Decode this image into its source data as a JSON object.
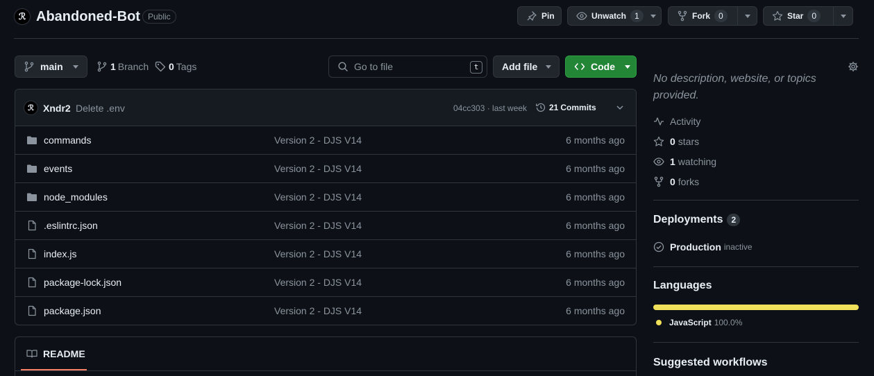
{
  "repo": {
    "name": "Abandoned-Bot",
    "visibility": "Public"
  },
  "actions": {
    "pin": "Pin",
    "unwatch": "Unwatch",
    "watch_count": "1",
    "fork": "Fork",
    "fork_count": "0",
    "star": "Star",
    "star_count": "0"
  },
  "toolbar": {
    "branch": "main",
    "branch_count": "1",
    "branch_label": "Branch",
    "tags_count": "0",
    "tags_label": "Tags",
    "go_to_file_placeholder": "Go to file",
    "go_to_file_key": "t",
    "add_file": "Add file",
    "code": "Code"
  },
  "commit": {
    "author": "Xndr2",
    "message": "Delete .env",
    "meta": "04cc303 · last week",
    "commits_count": "21",
    "commits_label": "Commits"
  },
  "files": [
    {
      "type": "dir",
      "name": "commands",
      "message": "Version 2 - DJS V14",
      "time": "6 months ago"
    },
    {
      "type": "dir",
      "name": "events",
      "message": "Version 2 - DJS V14",
      "time": "6 months ago"
    },
    {
      "type": "dir",
      "name": "node_modules",
      "message": "Version 2 - DJS V14",
      "time": "6 months ago"
    },
    {
      "type": "file",
      "name": ".eslintrc.json",
      "message": "Version 2 - DJS V14",
      "time": "6 months ago"
    },
    {
      "type": "file",
      "name": "index.js",
      "message": "Version 2 - DJS V14",
      "time": "6 months ago"
    },
    {
      "type": "file",
      "name": "package-lock.json",
      "message": "Version 2 - DJS V14",
      "time": "6 months ago"
    },
    {
      "type": "file",
      "name": "package.json",
      "message": "Version 2 - DJS V14",
      "time": "6 months ago"
    }
  ],
  "readme": {
    "tab": "README"
  },
  "sidebar": {
    "about": "No description, website, or topics provided.",
    "activity": "Activity",
    "stars_count": "0",
    "stars_label": "stars",
    "watching_count": "1",
    "watching_label": "watching",
    "forks_count": "0",
    "forks_label": "forks",
    "deployments_title": "Deployments",
    "deployments_count": "2",
    "deployment_name": "Production",
    "deployment_status": "inactive",
    "languages_title": "Languages",
    "language_name": "JavaScript",
    "language_percent": "100.0%",
    "language_fraction": 1.0,
    "suggested_title": "Suggested workflows"
  },
  "colors": {
    "accent_green": "#238636",
    "javascript": "#f1e05a",
    "readme_underline": "#f78166"
  }
}
